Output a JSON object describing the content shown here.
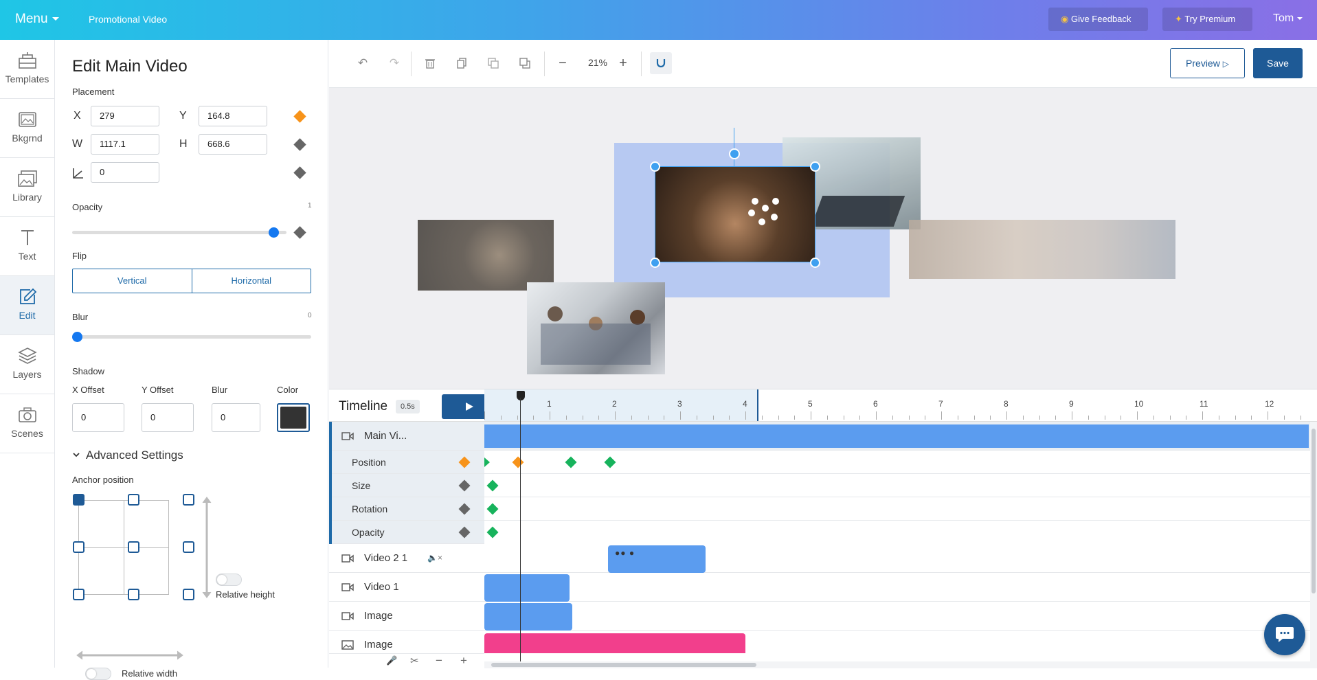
{
  "topbar": {
    "menu": "Menu",
    "project": "Promotional Video",
    "feedback": "Give Feedback",
    "premium": "Try Premium",
    "user": "Tom"
  },
  "nav": [
    {
      "label": "Templates",
      "icon": "templates-icon"
    },
    {
      "label": "Bkgrnd",
      "icon": "background-icon"
    },
    {
      "label": "Library",
      "icon": "library-icon"
    },
    {
      "label": "Text",
      "icon": "text-icon"
    },
    {
      "label": "Edit",
      "icon": "edit-icon"
    },
    {
      "label": "Layers",
      "icon": "layers-icon"
    },
    {
      "label": "Scenes",
      "icon": "camera-icon"
    }
  ],
  "panel": {
    "title": "Edit Main Video",
    "placement": "Placement",
    "x_label": "X",
    "x_value": "279",
    "y_label": "Y",
    "y_value": "164.8",
    "w_label": "W",
    "w_value": "1117.1",
    "h_label": "H",
    "h_value": "668.6",
    "rotation_value": "0",
    "opacity_label": "Opacity",
    "opacity_value": "1",
    "flip_label": "Flip",
    "flip_vertical": "Vertical",
    "flip_horizontal": "Horizontal",
    "blur_label": "Blur",
    "blur_value": "0",
    "shadow_label": "Shadow",
    "shadow_x_label": "X Offset",
    "shadow_x": "0",
    "shadow_y_label": "Y Offset",
    "shadow_y": "0",
    "shadow_blur_label": "Blur",
    "shadow_blur": "0",
    "shadow_color_label": "Color",
    "shadow_color": "#333333",
    "advanced": "Advanced Settings",
    "anchor_label": "Anchor position",
    "relative_height": "Relative height",
    "relative_width": "Relative width"
  },
  "toolbar": {
    "zoom": "21%",
    "preview": "Preview",
    "save": "Save"
  },
  "timeline": {
    "title": "Timeline",
    "step": "0.5s",
    "ruler": [
      "1",
      "2",
      "3",
      "4",
      "5",
      "6",
      "7",
      "8",
      "9",
      "10",
      "11",
      "12"
    ],
    "tracks": [
      {
        "name": "Main Vi..."
      },
      {
        "name": "Position"
      },
      {
        "name": "Size"
      },
      {
        "name": "Rotation"
      },
      {
        "name": "Opacity"
      },
      {
        "name": "Video 2 1"
      },
      {
        "name": "Video 1"
      },
      {
        "name": "Image"
      },
      {
        "name": "Image"
      }
    ]
  },
  "colors": {
    "accent": "#1e5a96",
    "bar_blue": "#5b9cef",
    "bar_pink": "#f23f8c",
    "keyframe_green": "#17b35c",
    "keyframe_orange": "#f7931a"
  }
}
